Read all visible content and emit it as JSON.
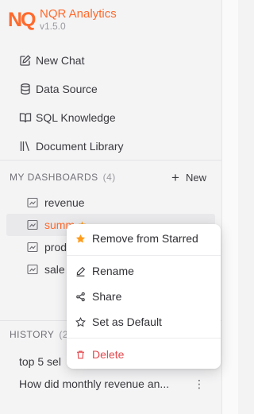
{
  "brand": {
    "logo_text": "NQ",
    "title": "NQR Analytics",
    "version": "v1.5.0"
  },
  "nav": [
    {
      "label": "New Chat",
      "icon": "edit-icon"
    },
    {
      "label": "Data Source",
      "icon": "database-icon"
    },
    {
      "label": "SQL Knowledge",
      "icon": "book-icon"
    },
    {
      "label": "Document Library",
      "icon": "library-icon"
    }
  ],
  "dashboards": {
    "heading": "MY DASHBOARDS",
    "count": "(4)",
    "new_label": "New",
    "items": [
      {
        "label": "revenue"
      },
      {
        "label": "summ",
        "starred": true
      },
      {
        "label": "prod"
      },
      {
        "label": "sale"
      }
    ]
  },
  "history": {
    "heading": "HISTORY",
    "count": "(2",
    "items": [
      {
        "label": "top 5 sel"
      },
      {
        "label": "How did monthly revenue an..."
      }
    ],
    "more_icon": "⋮"
  },
  "context_menu": {
    "items": [
      {
        "label": "Remove from Starred",
        "icon": "star-filled-icon"
      },
      {
        "label": "Rename",
        "icon": "pencil-icon"
      },
      {
        "label": "Share",
        "icon": "share-icon"
      },
      {
        "label": "Set as Default",
        "icon": "star-outline-icon"
      },
      {
        "label": "Delete",
        "icon": "trash-icon"
      }
    ]
  },
  "colors": {
    "accent": "#ff6a2c",
    "danger": "#e5484d",
    "star": "#ff9b1a"
  }
}
